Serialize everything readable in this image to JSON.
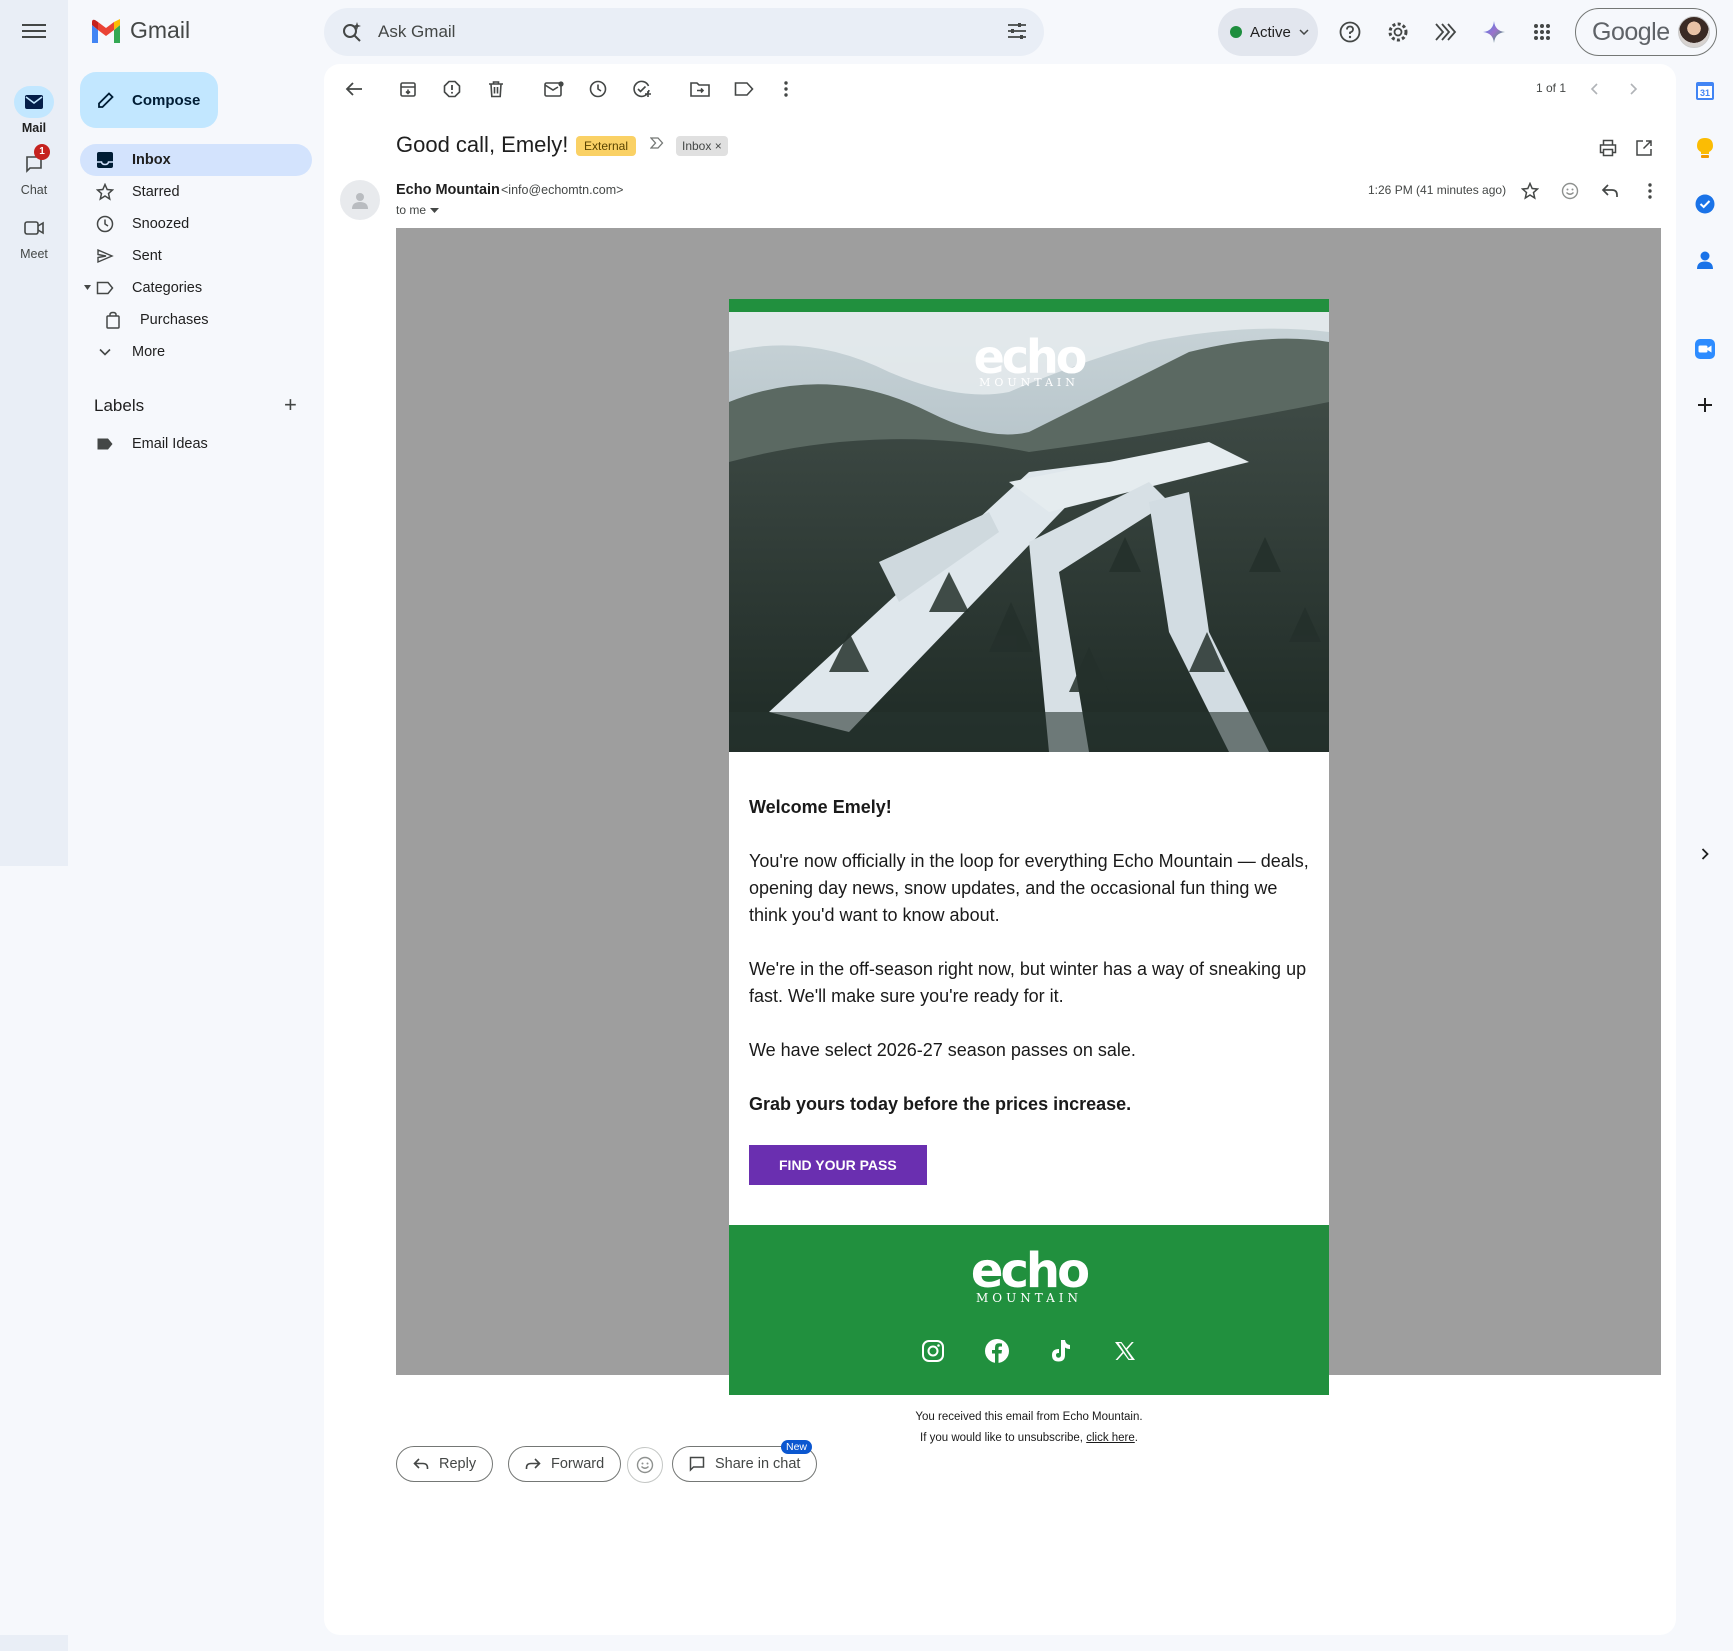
{
  "app": {
    "name": "Gmail"
  },
  "rail": {
    "items": [
      {
        "label": "Mail",
        "icon": "mail-icon"
      },
      {
        "label": "Chat",
        "icon": "chat-icon",
        "badge": "1"
      },
      {
        "label": "Meet",
        "icon": "meet-icon"
      }
    ]
  },
  "search": {
    "placeholder": "Ask Gmail"
  },
  "header": {
    "status_label": "Active",
    "account_word": "Google"
  },
  "sidebar": {
    "compose_label": "Compose",
    "items": [
      {
        "label": "Inbox",
        "icon": "inbox-icon"
      },
      {
        "label": "Starred",
        "icon": "star-icon"
      },
      {
        "label": "Snoozed",
        "icon": "clock-icon"
      },
      {
        "label": "Sent",
        "icon": "send-icon"
      },
      {
        "label": "Categories",
        "icon": "label-icon"
      },
      {
        "label": "Purchases",
        "icon": "shopping-bag-icon"
      },
      {
        "label": "More",
        "icon": "chevron-down-icon"
      }
    ],
    "labels_title": "Labels",
    "labels": [
      {
        "label": "Email Ideas",
        "icon": "label-filled-icon"
      }
    ]
  },
  "toolbar": {
    "pager": "1 of 1"
  },
  "message": {
    "subject": "Good call, Emely!",
    "tag_external": "External",
    "tag_inbox": "Inbox",
    "sender_name": "Echo Mountain",
    "sender_email": "<info@echomtn.com>",
    "to": "to me",
    "time": "1:26 PM (41 minutes ago)"
  },
  "email": {
    "brand_word": "echo",
    "brand_sub": "MOUNTAIN",
    "greeting": "Welcome Emely!",
    "p1": "You're now officially in the loop for everything Echo Mountain — deals, opening day news, snow updates, and the occasional fun thing we think you'd want to know about.",
    "p2": "We're in the off-season right now, but winter has a way of sneaking up fast. We'll make sure you're ready for it.",
    "p3": "We have select 2026-27 season passes on sale.",
    "p4": "Grab yours today before the prices increase.",
    "cta": "FIND YOUR PASS",
    "footer_line1": "You received this email from Echo Mountain.",
    "footer_line2_prefix": "If you would like to unsubscribe, ",
    "footer_link": "click here",
    "footer_line2_suffix": "."
  },
  "actions": {
    "reply": "Reply",
    "forward": "Forward",
    "share": "Share in chat",
    "new_badge": "New"
  },
  "colors": {
    "accent": "#0b57d0",
    "brand_green": "#21903e",
    "cta_purple": "#6a2fb0",
    "external_tag": "#fad165"
  }
}
